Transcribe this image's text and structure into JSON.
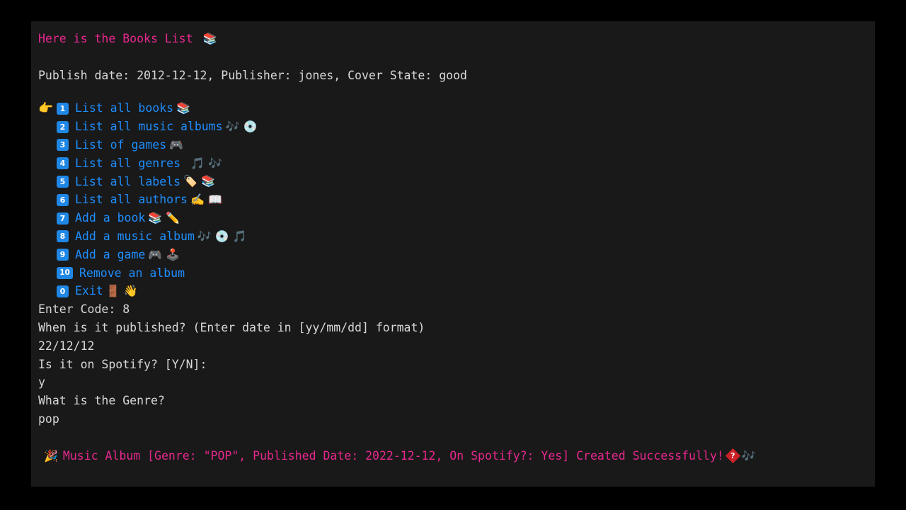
{
  "terminal": {
    "background": "#191919",
    "header": {
      "title_text": "Here is the Books List ",
      "title_icon": "📚",
      "title_color": "#e8288f",
      "detail_line": "Publish date: 2012-12-12, Publisher: jones, Cover State: good"
    },
    "menu": {
      "pointer_icon": "👉",
      "accent_color": "#1f8fff",
      "items": [
        {
          "code": "1",
          "label": "List all books",
          "emoji": "📚",
          "pointer": true
        },
        {
          "code": "2",
          "label": "List all music albums",
          "emoji": "🎶 💿",
          "pointer": false
        },
        {
          "code": "3",
          "label": "List of games",
          "emoji": "🎮",
          "pointer": false
        },
        {
          "code": "4",
          "label": "List all genres ",
          "emoji": "🎵 🎶",
          "pointer": false
        },
        {
          "code": "5",
          "label": "List all labels",
          "emoji": "🏷️ 📚",
          "pointer": false
        },
        {
          "code": "6",
          "label": "List all authors",
          "emoji": "✍️ 📖",
          "pointer": false
        },
        {
          "code": "7",
          "label": "Add a book",
          "emoji": "📚 ✏️",
          "pointer": false
        },
        {
          "code": "8",
          "label": "Add a music album",
          "emoji": "🎶 💿 🎵",
          "pointer": false
        },
        {
          "code": "9",
          "label": "Add a game",
          "emoji": "🎮 🕹️",
          "pointer": false
        },
        {
          "code": "10",
          "label": "Remove an album",
          "emoji": "",
          "pointer": false
        },
        {
          "code": "0",
          "label": "Exit",
          "emoji": "🚪 👋",
          "pointer": false
        }
      ]
    },
    "io": {
      "prompt_code": "Enter Code: 8",
      "prompt_published": "When is it published? (Enter date in [yy/mm/dd] format)",
      "input_published": "22/12/12",
      "prompt_spotify": "Is it on Spotify? [Y/N]:",
      "input_spotify": "y",
      "prompt_genre": "What is the Genre?",
      "input_genre": "pop"
    },
    "result": {
      "lead_icon": "🎉",
      "text": "Music Album [Genre: \"POP\", Published Date: 2022-12-12, On Spotify?: Yes] Created Successfully!",
      "tofu_glyph": "?",
      "trail_icon": "🎶",
      "color": "#e8288f"
    }
  }
}
